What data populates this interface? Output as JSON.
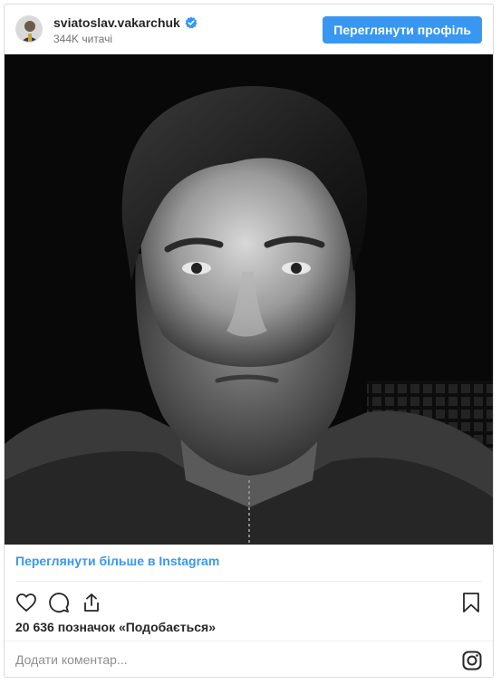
{
  "header": {
    "username": "sviatoslav.vakarchuk",
    "followers": "344K читачі",
    "view_profile_label": "Переглянути профіль"
  },
  "post": {
    "photo_description": "black-and-white portrait photo"
  },
  "footer": {
    "more_link": "Переглянути більше в Instagram",
    "likes": "20 636 позначок «Подобається»",
    "comment_placeholder": "Додати коментар..."
  },
  "colors": {
    "accent": "#3897f0",
    "text": "#262626",
    "muted": "#8e8e8e",
    "border": "#dbdbdb"
  },
  "icons": [
    "verified-icon",
    "heart-icon",
    "comment-icon",
    "share-icon",
    "bookmark-icon",
    "instagram-icon"
  ]
}
